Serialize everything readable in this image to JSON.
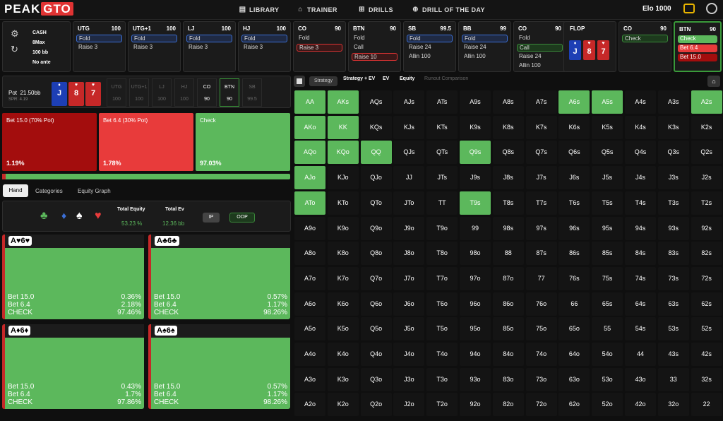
{
  "app": {
    "logo_a": "PEAK",
    "logo_b": "GTO"
  },
  "nav": [
    {
      "label": "LIBRARY",
      "icon": "book-icon"
    },
    {
      "label": "TRAINER",
      "icon": "controller-icon"
    },
    {
      "label": "DRILLS",
      "icon": "grid-icon"
    },
    {
      "label": "DRILL OF THE DAY",
      "icon": "plus-circle-icon"
    }
  ],
  "elo": {
    "label": "Elo",
    "value": "1000"
  },
  "game": {
    "type": "CASH",
    "table": "8Max",
    "stack": "100 bb",
    "ante": "No ante"
  },
  "seats": [
    {
      "name": "UTG",
      "stack": "100",
      "actions": [
        "Fold",
        "Raise 3"
      ],
      "sel": 0
    },
    {
      "name": "UTG+1",
      "stack": "100",
      "actions": [
        "Fold",
        "Raise 3"
      ],
      "sel": 0
    },
    {
      "name": "LJ",
      "stack": "100",
      "actions": [
        "Fold",
        "Raise 3"
      ],
      "sel": 0
    },
    {
      "name": "HJ",
      "stack": "100",
      "actions": [
        "Fold",
        "Raise 3"
      ],
      "sel": 0
    },
    {
      "name": "CO",
      "stack": "90",
      "actions": [
        "Fold",
        "Raise 3"
      ],
      "sel": 1
    },
    {
      "name": "BTN",
      "stack": "90",
      "actions": [
        "Fold",
        "Call",
        "Raise 10"
      ],
      "sel": 2
    },
    {
      "name": "SB",
      "stack": "99.5",
      "actions": [
        "Fold",
        "Raise 24",
        "Allin 100"
      ],
      "sel": 0
    },
    {
      "name": "BB",
      "stack": "99",
      "actions": [
        "Fold",
        "Raise 24",
        "Allin 100"
      ],
      "sel": 0
    },
    {
      "name": "CO",
      "stack": "90",
      "actions": [
        "Fold",
        "Call",
        "Raise 24",
        "Allin 100"
      ],
      "sel": 1
    }
  ],
  "flop": {
    "label": "FLOP",
    "cards": [
      {
        "rank": "J",
        "suit": "♦",
        "color": "blue"
      },
      {
        "rank": "8",
        "suit": "♥",
        "color": "red"
      },
      {
        "rank": "7",
        "suit": "♥",
        "color": "red"
      }
    ]
  },
  "co_after": {
    "name": "CO",
    "stack": "90",
    "action": "Check"
  },
  "btn_final": {
    "name": "BTN",
    "stack": "90",
    "actions": [
      "Check",
      "Bet 6.4",
      "Bet 15.0"
    ]
  },
  "pot": {
    "label": "Pot",
    "value": "21.50bb",
    "spr": "SPR: 4.19"
  },
  "hero_cards": [
    {
      "rank": "J",
      "suit": "♦",
      "color": "blue"
    },
    {
      "rank": "8",
      "suit": "♥",
      "color": "red"
    },
    {
      "rank": "7",
      "suit": "♥",
      "color": "red"
    }
  ],
  "minis": [
    {
      "name": "UTG",
      "v": "100"
    },
    {
      "name": "UTG+1",
      "v": "100"
    },
    {
      "name": "LJ",
      "v": "100"
    },
    {
      "name": "HJ",
      "v": "100"
    },
    {
      "name": "CO",
      "v": "90"
    },
    {
      "name": "BTN",
      "v": "90"
    },
    {
      "name": "SB",
      "v": "99.5"
    }
  ],
  "strategy": [
    {
      "label": "Bet 15.0 (70% Pot)",
      "pct": "1.19%",
      "color": "#a30d0d"
    },
    {
      "label": "Bet 6.4 (30% Pot)",
      "pct": "1.78%",
      "color": "#e83b3b"
    },
    {
      "label": "Check",
      "pct": "97.03%",
      "color": "#5cb85c"
    }
  ],
  "tabs": [
    "Hand",
    "Categories",
    "Equity Graph"
  ],
  "equity": {
    "title": "Total Equity",
    "value": "53.23 %",
    "ev_title": "Total Ev",
    "ev": "12.36 bb",
    "ip": "IP",
    "oop": "OOP"
  },
  "suit_icons": [
    "♣",
    "♦",
    "♠",
    "♥"
  ],
  "combos": [
    {
      "label": "A♥6♥",
      "rows": [
        [
          "Bet 15.0",
          "0.36%"
        ],
        [
          "Bet 6.4",
          "2.18%"
        ],
        [
          "CHECK",
          "97.46%"
        ]
      ]
    },
    {
      "label": "A♣6♣",
      "rows": [
        [
          "Bet 15.0",
          "0.57%"
        ],
        [
          "Bet 6.4",
          "1.17%"
        ],
        [
          "CHECK",
          "98.26%"
        ]
      ]
    },
    {
      "label": "A♦6♦",
      "rows": [
        [
          "Bet 15.0",
          "0.43%"
        ],
        [
          "Bet 6.4",
          "1.7%"
        ],
        [
          "CHECK",
          "97.86%"
        ]
      ]
    },
    {
      "label": "A♠6♠",
      "rows": [
        [
          "Bet 15.0",
          "0.57%"
        ],
        [
          "Bet 6.4",
          "1.17%"
        ],
        [
          "CHECK",
          "98.26%"
        ]
      ]
    }
  ],
  "grid_tabs": [
    "Strategy",
    "Strategy + EV",
    "EV",
    "Equity",
    "Runout Comparison"
  ],
  "grid": [
    [
      "AA",
      "AKs",
      "AQs",
      "AJs",
      "ATs",
      "A9s",
      "A8s",
      "A7s",
      "A6s",
      "A5s",
      "A4s",
      "A3s",
      "A2s"
    ],
    [
      "AKo",
      "KK",
      "KQs",
      "KJs",
      "KTs",
      "K9s",
      "K8s",
      "K7s",
      "K6s",
      "K5s",
      "K4s",
      "K3s",
      "K2s"
    ],
    [
      "AQo",
      "KQo",
      "QQ",
      "QJs",
      "QTs",
      "Q9s",
      "Q8s",
      "Q7s",
      "Q6s",
      "Q5s",
      "Q4s",
      "Q3s",
      "Q2s"
    ],
    [
      "AJo",
      "KJo",
      "QJo",
      "JJ",
      "JTs",
      "J9s",
      "J8s",
      "J7s",
      "J6s",
      "J5s",
      "J4s",
      "J3s",
      "J2s"
    ],
    [
      "ATo",
      "KTo",
      "QTo",
      "JTo",
      "TT",
      "T9s",
      "T8s",
      "T7s",
      "T6s",
      "T5s",
      "T4s",
      "T3s",
      "T2s"
    ],
    [
      "A9o",
      "K9o",
      "Q9o",
      "J9o",
      "T9o",
      "99",
      "98s",
      "97s",
      "96s",
      "95s",
      "94s",
      "93s",
      "92s"
    ],
    [
      "A8o",
      "K8o",
      "Q8o",
      "J8o",
      "T8o",
      "98o",
      "88",
      "87s",
      "86s",
      "85s",
      "84s",
      "83s",
      "82s"
    ],
    [
      "A7o",
      "K7o",
      "Q7o",
      "J7o",
      "T7o",
      "97o",
      "87o",
      "77",
      "76s",
      "75s",
      "74s",
      "73s",
      "72s"
    ],
    [
      "A6o",
      "K6o",
      "Q6o",
      "J6o",
      "T6o",
      "96o",
      "86o",
      "76o",
      "66",
      "65s",
      "64s",
      "63s",
      "62s"
    ],
    [
      "A5o",
      "K5o",
      "Q5o",
      "J5o",
      "T5o",
      "95o",
      "85o",
      "75o",
      "65o",
      "55",
      "54s",
      "53s",
      "52s"
    ],
    [
      "A4o",
      "K4o",
      "Q4o",
      "J4o",
      "T4o",
      "94o",
      "84o",
      "74o",
      "64o",
      "54o",
      "44",
      "43s",
      "42s"
    ],
    [
      "A3o",
      "K3o",
      "Q3o",
      "J3o",
      "T3o",
      "93o",
      "83o",
      "73o",
      "63o",
      "53o",
      "43o",
      "33",
      "32s"
    ],
    [
      "A2o",
      "K2o",
      "Q2o",
      "J2o",
      "T2o",
      "92o",
      "82o",
      "72o",
      "62o",
      "52o",
      "42o",
      "32o",
      "22"
    ]
  ],
  "grid_fill": [
    [
      1,
      1,
      0.3,
      0,
      0,
      0,
      0.15,
      0.3,
      1,
      1,
      0,
      0.4,
      1
    ],
    [
      1,
      1,
      0,
      0.3,
      0.2,
      0,
      0.4,
      0.4,
      0,
      0.2,
      0,
      0,
      0
    ],
    [
      1,
      1,
      1,
      0.3,
      0.2,
      1,
      0,
      0,
      0,
      0,
      0,
      0,
      0
    ],
    [
      1,
      0.2,
      0.2,
      0.2,
      0.3,
      0.2,
      0,
      0,
      0,
      0,
      0,
      0,
      0
    ],
    [
      1,
      0,
      0,
      0.2,
      0.3,
      1,
      0,
      0,
      0,
      0,
      0,
      0,
      0
    ],
    [
      0,
      0,
      0,
      0,
      0,
      0.2,
      0,
      0,
      0,
      0,
      0,
      0,
      0
    ],
    [
      0,
      0,
      0,
      0,
      0,
      0,
      0.15,
      0.15,
      0,
      0,
      0,
      0,
      0
    ],
    [
      0,
      0,
      0,
      0,
      0,
      0,
      0,
      0,
      0.3,
      0,
      0,
      0,
      0
    ],
    [
      0,
      0,
      0,
      0,
      0,
      0,
      0,
      0,
      0.3,
      0.4,
      0,
      0,
      0
    ],
    [
      0,
      0,
      0,
      0,
      0,
      0,
      0,
      0,
      0,
      0.3,
      0.2,
      0,
      0
    ],
    [
      0,
      0,
      0,
      0,
      0,
      0,
      0,
      0,
      0,
      0,
      0,
      0,
      0
    ],
    [
      0,
      0,
      0,
      0,
      0,
      0,
      0,
      0,
      0,
      0,
      0,
      0,
      0
    ],
    [
      0,
      0,
      0,
      0,
      0,
      0,
      0,
      0,
      0,
      0,
      0,
      0,
      0
    ]
  ]
}
